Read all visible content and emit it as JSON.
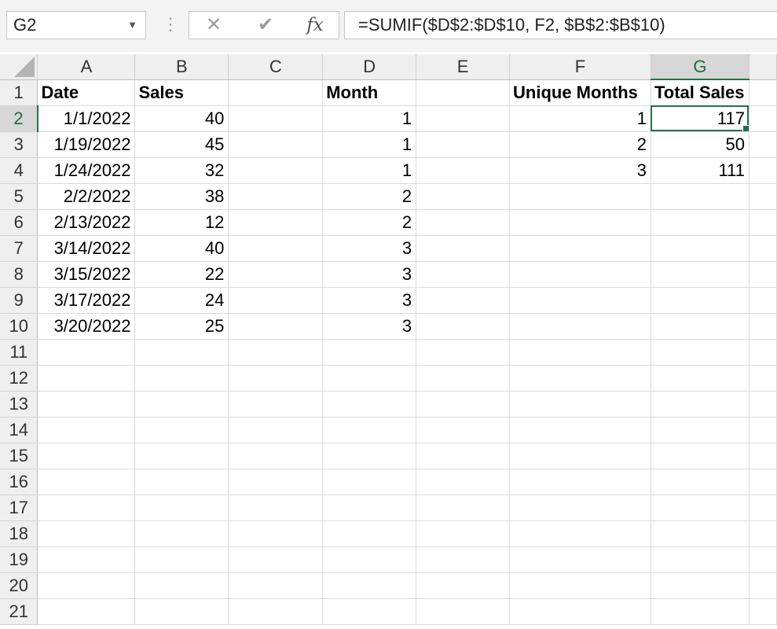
{
  "name_box": {
    "value": "G2",
    "dropdown_icon": "chevron-down-icon"
  },
  "formula_bar": {
    "cancel_icon": "close-icon",
    "enter_icon": "check-icon",
    "fx_label": "fx",
    "formula": "=SUMIF($D$2:$D$10, F2, $B$2:$B$10)"
  },
  "grid": {
    "columns": [
      "A",
      "B",
      "C",
      "D",
      "E",
      "F",
      "G"
    ],
    "active_column": "G",
    "active_row": "2",
    "rows": [
      {
        "num": "1",
        "cells": [
          "Date",
          "Sales",
          "",
          "Month",
          "",
          "Unique Months",
          "Total Sales"
        ]
      },
      {
        "num": "2",
        "cells": [
          "1/1/2022",
          "40",
          "",
          "1",
          "",
          "1",
          "117"
        ]
      },
      {
        "num": "3",
        "cells": [
          "1/19/2022",
          "45",
          "",
          "1",
          "",
          "2",
          "50"
        ]
      },
      {
        "num": "4",
        "cells": [
          "1/24/2022",
          "32",
          "",
          "1",
          "",
          "3",
          "111"
        ]
      },
      {
        "num": "5",
        "cells": [
          "2/2/2022",
          "38",
          "",
          "2",
          "",
          "",
          ""
        ]
      },
      {
        "num": "6",
        "cells": [
          "2/13/2022",
          "12",
          "",
          "2",
          "",
          "",
          ""
        ]
      },
      {
        "num": "7",
        "cells": [
          "3/14/2022",
          "40",
          "",
          "3",
          "",
          "",
          ""
        ]
      },
      {
        "num": "8",
        "cells": [
          "3/15/2022",
          "22",
          "",
          "3",
          "",
          "",
          ""
        ]
      },
      {
        "num": "9",
        "cells": [
          "3/17/2022",
          "24",
          "",
          "3",
          "",
          "",
          ""
        ]
      },
      {
        "num": "10",
        "cells": [
          "3/20/2022",
          "25",
          "",
          "3",
          "",
          "",
          ""
        ]
      },
      {
        "num": "11",
        "cells": [
          "",
          "",
          "",
          "",
          "",
          "",
          ""
        ]
      },
      {
        "num": "12",
        "cells": [
          "",
          "",
          "",
          "",
          "",
          "",
          ""
        ]
      },
      {
        "num": "13",
        "cells": [
          "",
          "",
          "",
          "",
          "",
          "",
          ""
        ]
      },
      {
        "num": "14",
        "cells": [
          "",
          "",
          "",
          "",
          "",
          "",
          ""
        ]
      },
      {
        "num": "15",
        "cells": [
          "",
          "",
          "",
          "",
          "",
          "",
          ""
        ]
      },
      {
        "num": "16",
        "cells": [
          "",
          "",
          "",
          "",
          "",
          "",
          ""
        ]
      },
      {
        "num": "17",
        "cells": [
          "",
          "",
          "",
          "",
          "",
          "",
          ""
        ]
      },
      {
        "num": "18",
        "cells": [
          "",
          "",
          "",
          "",
          "",
          "",
          ""
        ]
      },
      {
        "num": "19",
        "cells": [
          "",
          "",
          "",
          "",
          "",
          "",
          ""
        ]
      },
      {
        "num": "20",
        "cells": [
          "",
          "",
          "",
          "",
          "",
          "",
          ""
        ]
      },
      {
        "num": "21",
        "cells": [
          "",
          "",
          "",
          "",
          "",
          "",
          ""
        ]
      }
    ]
  }
}
